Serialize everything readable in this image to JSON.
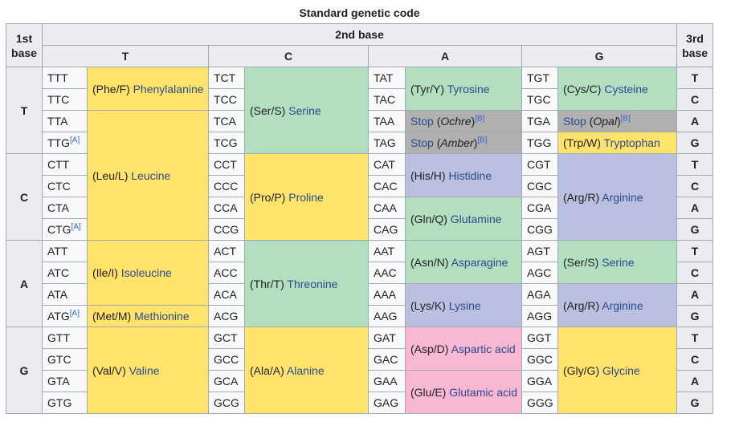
{
  "title": "Standard genetic code",
  "header": {
    "first_base": [
      "1st",
      "base"
    ],
    "second_base": "2nd base",
    "third_base": [
      "3rd",
      "base"
    ],
    "second_base_letters": [
      "T",
      "C",
      "A",
      "G"
    ]
  },
  "colors": {
    "nonpolar": "#ffe36b",
    "polar": "#b3dec0",
    "basic": "#bbbfe0",
    "acidic": "#f8b7d3",
    "stop": "#b0b0b0",
    "link": "#2a4b8d"
  },
  "footnote_A": "[A]",
  "footnote_B": "[B]",
  "blocks": [
    {
      "first": "T",
      "third": [
        "T",
        "C",
        "A",
        "G"
      ],
      "codons": {
        "T": [
          "TTT",
          "TTC",
          "TTA",
          "TTG"
        ],
        "C": [
          "TCT",
          "TCC",
          "TCA",
          "TCG"
        ],
        "A": [
          "TAT",
          "TAC",
          "TAA",
          "TAG"
        ],
        "G": [
          "TGT",
          "TGC",
          "TGA",
          "TGG"
        ]
      }
    },
    {
      "first": "C",
      "third": [
        "T",
        "C",
        "A",
        "G"
      ],
      "codons": {
        "T": [
          "CTT",
          "CTC",
          "CTA",
          "CTG"
        ],
        "C": [
          "CCT",
          "CCC",
          "CCA",
          "CCG"
        ],
        "A": [
          "CAT",
          "CAC",
          "CAA",
          "CAG"
        ],
        "G": [
          "CGT",
          "CGC",
          "CGA",
          "CGG"
        ]
      }
    },
    {
      "first": "A",
      "third": [
        "T",
        "C",
        "A",
        "G"
      ],
      "codons": {
        "T": [
          "ATT",
          "ATC",
          "ATA",
          "ATG"
        ],
        "C": [
          "ACT",
          "ACC",
          "ACA",
          "ACG"
        ],
        "A": [
          "AAT",
          "AAC",
          "AAA",
          "AAG"
        ],
        "G": [
          "AGT",
          "AGC",
          "AGA",
          "AGG"
        ]
      }
    },
    {
      "first": "G",
      "third": [
        "T",
        "C",
        "A",
        "G"
      ],
      "codons": {
        "T": [
          "GTT",
          "GTC",
          "GTA",
          "GTG"
        ],
        "C": [
          "GCT",
          "GCC",
          "GCA",
          "GCG"
        ],
        "A": [
          "GAT",
          "GAC",
          "GAA",
          "GAG"
        ],
        "G": [
          "GGT",
          "GGC",
          "GGA",
          "GGG"
        ]
      }
    }
  ],
  "amino_acids": {
    "phe": {
      "abbr": "(Phe/F)",
      "name": "Phenylalanine"
    },
    "leu": {
      "abbr": "(Leu/L)",
      "name": "Leucine"
    },
    "ser1": {
      "abbr": "(Ser/S)",
      "name": "Serine"
    },
    "tyr": {
      "abbr": "(Tyr/Y)",
      "name": "Tyrosine"
    },
    "ochre": {
      "stop": "Stop",
      "open": " (",
      "name": "Ochre",
      "close": ")"
    },
    "amber": {
      "stop": "Stop",
      "open": " (",
      "name": "Amber",
      "close": ")"
    },
    "cys": {
      "abbr": "(Cys/C)",
      "name": "Cysteine"
    },
    "opal": {
      "stop": "Stop",
      "open": " (",
      "name": "Opal",
      "close": ")"
    },
    "trp": {
      "abbr": "(Trp/W)",
      "name": "Tryptophan"
    },
    "pro": {
      "abbr": "(Pro/P)",
      "name": "Proline"
    },
    "his": {
      "abbr": "(His/H)",
      "name": "Histidine"
    },
    "gln": {
      "abbr": "(Gln/Q)",
      "name": "Glutamine"
    },
    "arg1": {
      "abbr": "(Arg/R)",
      "name": "Arginine"
    },
    "ile": {
      "abbr": "(Ile/I)",
      "name": "Isoleucine"
    },
    "met": {
      "abbr": "(Met/M)",
      "name": "Methionine"
    },
    "thr": {
      "abbr": "(Thr/T)",
      "name": "Threonine"
    },
    "asn": {
      "abbr": "(Asn/N)",
      "name": "Asparagine"
    },
    "ser2": {
      "abbr": "(Ser/S)",
      "name": "Serine"
    },
    "lys": {
      "abbr": "(Lys/K)",
      "name": "Lysine"
    },
    "arg2": {
      "abbr": "(Arg/R)",
      "name": "Arginine"
    },
    "val": {
      "abbr": "(Val/V)",
      "name": "Valine"
    },
    "ala": {
      "abbr": "(Ala/A)",
      "name": "Alanine"
    },
    "asp": {
      "abbr": "(Asp/D)",
      "name": "Aspartic acid"
    },
    "glu": {
      "abbr": "(Glu/E)",
      "name": "Glutamic acid"
    },
    "gly": {
      "abbr": "(Gly/G)",
      "name": "Glycine"
    }
  }
}
